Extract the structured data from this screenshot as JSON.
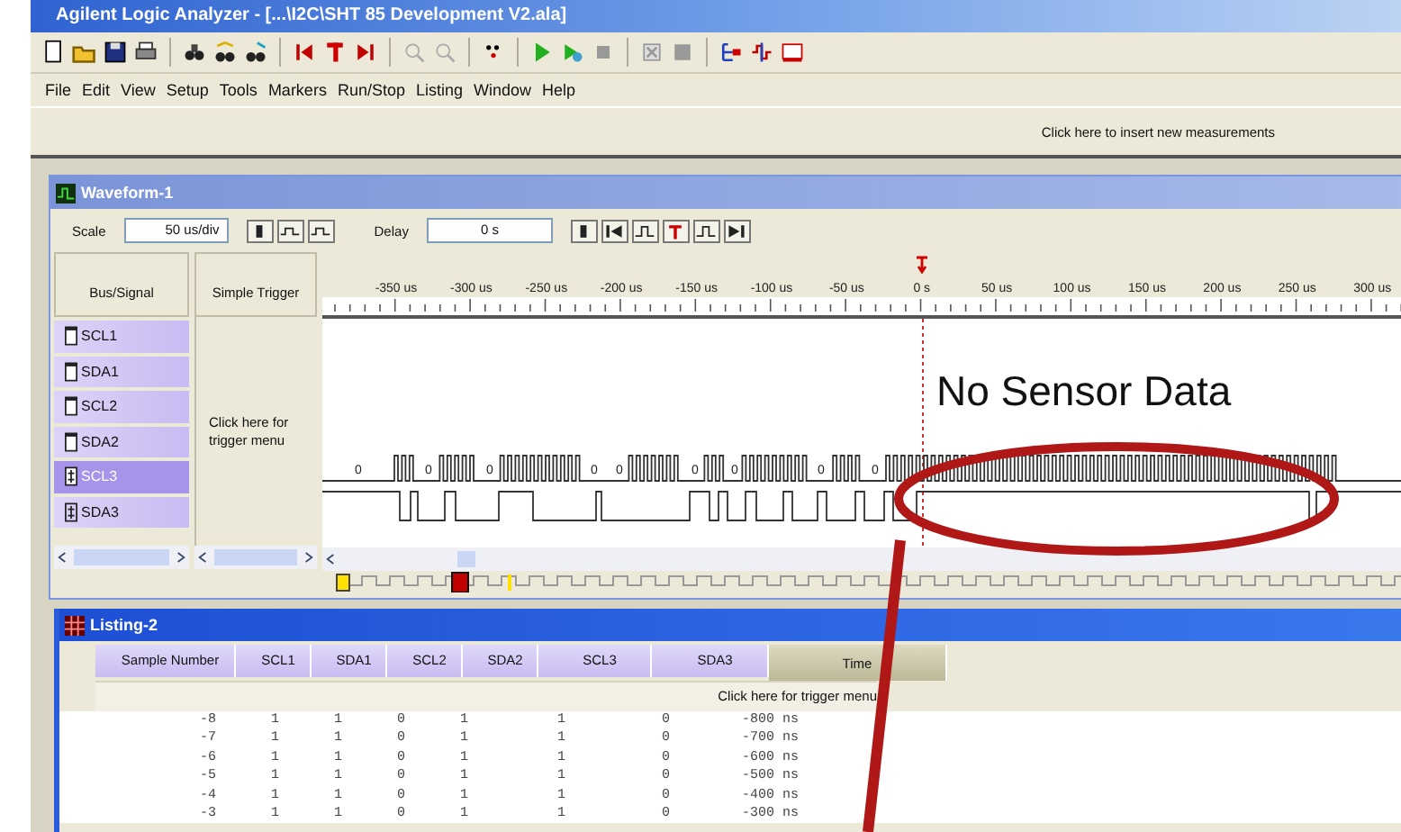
{
  "window": {
    "title": "Agilent Logic Analyzer - [...\\I2C\\SHT 85 Development V2.ala]"
  },
  "menu": [
    "File",
    "Edit",
    "View",
    "Setup",
    "Tools",
    "Markers",
    "Run/Stop",
    "Listing",
    "Window",
    "Help"
  ],
  "measurement_bar": {
    "hint": "Click here to insert new measurements"
  },
  "waveform": {
    "title": "Waveform-1",
    "scale_label": "Scale",
    "scale": "50 us/div",
    "delay_label": "Delay",
    "delay": "0 s",
    "column_headers": [
      "Bus/Signal",
      "Simple Trigger"
    ],
    "trigger_hint": "Click here for trigger menu",
    "time_ticks": [
      "-350 us",
      "-300 us",
      "-250 us",
      "-200 us",
      "-150 us",
      "-100 us",
      "-50 us",
      "0 s",
      "50 us",
      "100 us",
      "150 us",
      "200 us",
      "250 us",
      "300 us"
    ],
    "signals": [
      {
        "name": "SCL1",
        "kind": "bit",
        "selected": false
      },
      {
        "name": "SDA1",
        "kind": "bit",
        "selected": false
      },
      {
        "name": "SCL2",
        "kind": "bit",
        "selected": false
      },
      {
        "name": "SDA2",
        "kind": "bit",
        "selected": false
      },
      {
        "name": "SCL3",
        "kind": "bus",
        "selected": true
      },
      {
        "name": "SDA3",
        "kind": "bus",
        "selected": false
      }
    ],
    "bus_values": [
      "0",
      "0",
      "0",
      "0",
      "0",
      "0",
      "0",
      "0",
      "0"
    ]
  },
  "listing": {
    "title": "Listing-2",
    "columns": [
      {
        "label": "Sample Number",
        "kind": "signal"
      },
      {
        "label": "SCL1",
        "kind": "signal"
      },
      {
        "label": "SDA1",
        "kind": "signal"
      },
      {
        "label": "SCL2",
        "kind": "signal"
      },
      {
        "label": "SDA2",
        "kind": "signal"
      },
      {
        "label": "SCL3",
        "kind": "signal"
      },
      {
        "label": "SDA3",
        "kind": "signal"
      },
      {
        "label": "Time",
        "kind": "time"
      }
    ],
    "trigger_hint": "Click here for trigger menu",
    "rows": [
      [
        "-8",
        "1",
        "1",
        "0",
        "1",
        "1",
        "0",
        "-800 ns"
      ],
      [
        "-7",
        "1",
        "1",
        "0",
        "1",
        "1",
        "0",
        "-700 ns"
      ],
      [
        "-6",
        "1",
        "1",
        "0",
        "1",
        "1",
        "0",
        "-600 ns"
      ],
      [
        "-5",
        "1",
        "1",
        "0",
        "1",
        "1",
        "0",
        "-500 ns"
      ],
      [
        "-4",
        "1",
        "1",
        "0",
        "1",
        "1",
        "0",
        "-400 ns"
      ],
      [
        "-3",
        "1",
        "1",
        "0",
        "1",
        "1",
        "0",
        "-300 ns"
      ]
    ]
  },
  "annotation": {
    "text": "No Sensor Data"
  }
}
